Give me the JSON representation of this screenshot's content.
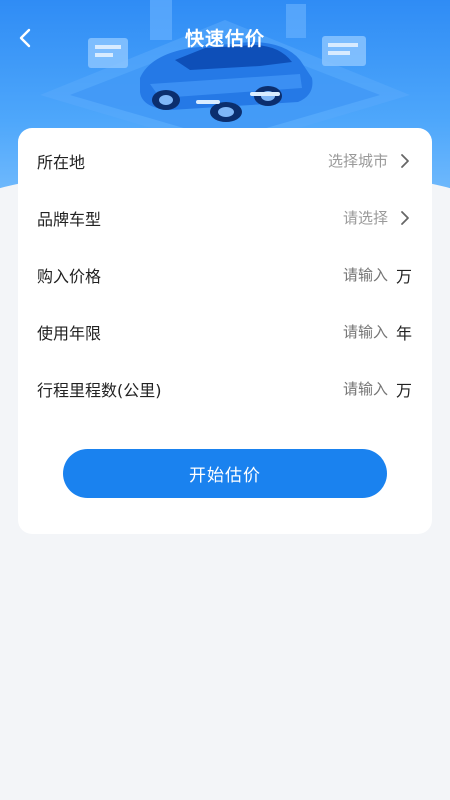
{
  "header": {
    "title": "快速估价"
  },
  "form": {
    "rows": [
      {
        "label": "所在地",
        "value": "选择城市",
        "type": "select"
      },
      {
        "label": "品牌车型",
        "value": "请选择",
        "type": "select"
      },
      {
        "label": "购入价格",
        "placeholder": "请输入",
        "unit": "万",
        "type": "input"
      },
      {
        "label": "使用年限",
        "placeholder": "请输入",
        "unit": "年",
        "type": "input"
      },
      {
        "label": "行程里程数(公里)",
        "placeholder": "请输入",
        "unit": "万",
        "type": "input"
      }
    ],
    "submit_label": "开始估价"
  },
  "colors": {
    "accent": "#1a82ef",
    "hero_top": "#2f8cf5",
    "background": "#f3f5f8"
  },
  "icons": {
    "back": "chevron-left-icon",
    "row_arrow": "chevron-right-icon",
    "illustration": "car-illustration"
  }
}
